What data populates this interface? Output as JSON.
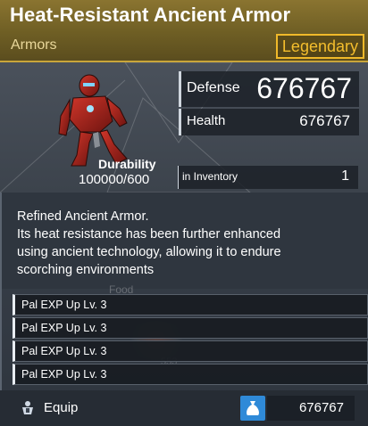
{
  "item": {
    "name": "Heat-Resistant Ancient Armor",
    "category": "Armors",
    "rarity": "Legendary",
    "rarity_color": "#f4be2d"
  },
  "stats": {
    "defense_label": "Defense",
    "defense_value": "676767",
    "health_label": "Health",
    "health_value": "676767",
    "durability_label": "Durability",
    "durability_value": "100000/600",
    "inventory_label": "in Inventory",
    "inventory_value": "1"
  },
  "description": {
    "lines": [
      "Refined Ancient Armor.",
      "Its heat resistance has been further enhanced",
      "using ancient technology, allowing it to endure",
      "scorching environments"
    ]
  },
  "background": {
    "ghost_label": "Food",
    "ghost_number": "553"
  },
  "passives": [
    {
      "label": "Pal EXP Up Lv. 3"
    },
    {
      "label": "Pal EXP Up Lv. 3"
    },
    {
      "label": "Pal EXP Up Lv. 3"
    },
    {
      "label": "Pal EXP Up Lv. 3"
    }
  ],
  "actions": {
    "equip_label": "Equip",
    "price_value": "676767",
    "equip_icon": "armor-stand-icon",
    "price_icon": "money-bag-icon",
    "price_icon_color": "#2f8ad8"
  }
}
